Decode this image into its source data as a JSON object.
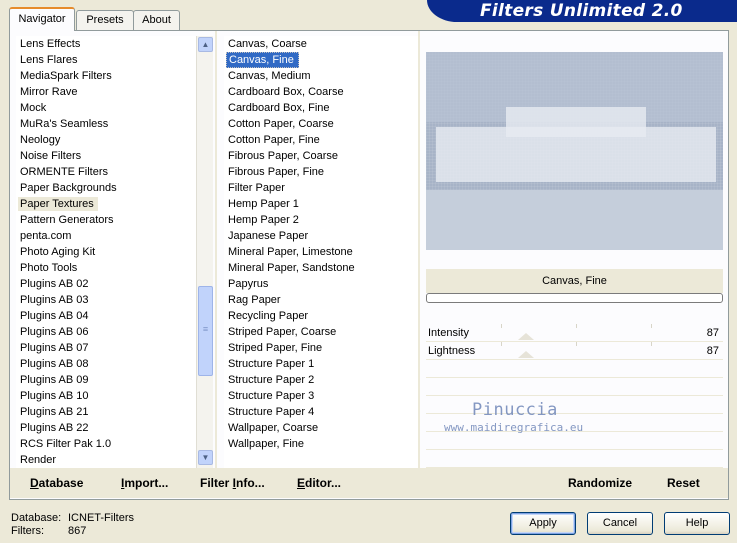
{
  "tabs": [
    {
      "label": "Navigator",
      "active": true
    },
    {
      "label": "Presets",
      "active": false
    },
    {
      "label": "About",
      "active": false
    }
  ],
  "banner_title": "Filters Unlimited 2.0",
  "categories": [
    "Lens Effects",
    "Lens Flares",
    "MediaSpark Filters",
    "Mirror Rave",
    "Mock",
    "MuRa's Seamless",
    "Neology",
    "Noise Filters",
    "ORMENTE Filters",
    "Paper Backgrounds",
    "Paper Textures",
    "Pattern Generators",
    "penta.com",
    "Photo Aging Kit",
    "Photo Tools",
    "Plugins AB 02",
    "Plugins AB 03",
    "Plugins AB 04",
    "Plugins AB 06",
    "Plugins AB 07",
    "Plugins AB 08",
    "Plugins AB 09",
    "Plugins AB 10",
    "Plugins AB 21",
    "Plugins AB 22",
    "RCS Filter Pak 1.0",
    "Render"
  ],
  "selected_category": "Paper Textures",
  "filters": [
    "Canvas, Coarse",
    "Canvas, Fine",
    "Canvas, Medium",
    "Cardboard Box, Coarse",
    "Cardboard Box, Fine",
    "Cotton Paper, Coarse",
    "Cotton Paper, Fine",
    "Fibrous Paper, Coarse",
    "Fibrous Paper, Fine",
    "Filter Paper",
    "Hemp Paper 1",
    "Hemp Paper 2",
    "Japanese Paper",
    "Mineral Paper, Limestone",
    "Mineral Paper, Sandstone",
    "Papyrus",
    "Rag Paper",
    "Recycling Paper",
    "Striped Paper, Coarse",
    "Striped Paper, Fine",
    "Structure Paper 1",
    "Structure Paper 2",
    "Structure Paper 3",
    "Structure Paper 4",
    "Wallpaper, Coarse",
    "Wallpaper, Fine"
  ],
  "selected_filter": "Canvas, Fine",
  "preview_title": "Canvas, Fine",
  "params": [
    {
      "label": "Intensity",
      "value": "87"
    },
    {
      "label": "Lightness",
      "value": "87"
    }
  ],
  "watermark": {
    "line1": "Pinuccia",
    "line2": "www.maidiregrafica.eu"
  },
  "toolbar": {
    "database": "Database",
    "import": "Import...",
    "filter_info": "Filter Info...",
    "editor": "Editor...",
    "randomize": "Randomize",
    "reset": "Reset"
  },
  "status": {
    "database_label": "Database:",
    "database_value": "ICNET-Filters",
    "filters_label": "Filters:",
    "filters_value": "867"
  },
  "buttons": {
    "apply": "Apply",
    "cancel": "Cancel",
    "help": "Help"
  },
  "colors": {
    "selection": "#316ac5",
    "banner": "#0a2a8c",
    "dialog_bg": "#ece9d8"
  }
}
